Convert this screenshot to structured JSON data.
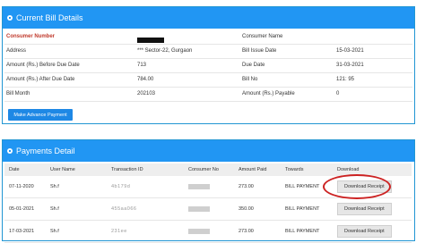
{
  "bill": {
    "title": "Current Bill Details",
    "rows": [
      {
        "l_label": "Consumer Number",
        "l_value": "",
        "r_label": "Consumer Name",
        "r_value": ""
      },
      {
        "l_label": "Address",
        "l_value": "*** Sector-22, Gurgaon",
        "r_label": "Bill Issue Date",
        "r_value": "15-03-2021"
      },
      {
        "l_label": "Amount (Rs.) Before Due Date",
        "l_value": "713",
        "r_label": "Due Date",
        "r_value": "31-03-2021"
      },
      {
        "l_label": "Amount (Rs.) After Due Date",
        "l_value": "784.00",
        "r_label": "Bill No",
        "r_value": "121:          95"
      },
      {
        "l_label": "Bill Month",
        "l_value": "202103",
        "r_label": "Amount (Rs.) Payable",
        "r_value": "0"
      }
    ],
    "advance_button": "Make Advance Payment"
  },
  "payments": {
    "title": "Payments Detail",
    "columns": [
      "Date",
      "User Name",
      "Transaction ID",
      "Consumer No",
      "Amount Paid",
      "Towards",
      "Download"
    ],
    "rows": [
      {
        "date": "07-11-2020",
        "user": "Sh.f",
        "txn": "4b179d",
        "consumer": "",
        "amount": "273.00",
        "towards": "BILL PAYMENT",
        "download": "Download Receipt"
      },
      {
        "date": "05-01-2021",
        "user": "Sh.f",
        "txn": "455aa066",
        "consumer": "",
        "amount": "350.00",
        "towards": "BILL PAYMENT",
        "download": "Download Receipt"
      },
      {
        "date": "17-03-2021",
        "user": "Sh.f",
        "txn": "231ee",
        "consumer": "",
        "amount": "273.00",
        "towards": "BILL PAYMENT",
        "download": "Download Receipt"
      }
    ]
  },
  "colors": {
    "header": "#2196f3",
    "highlight": "#cc2222"
  }
}
